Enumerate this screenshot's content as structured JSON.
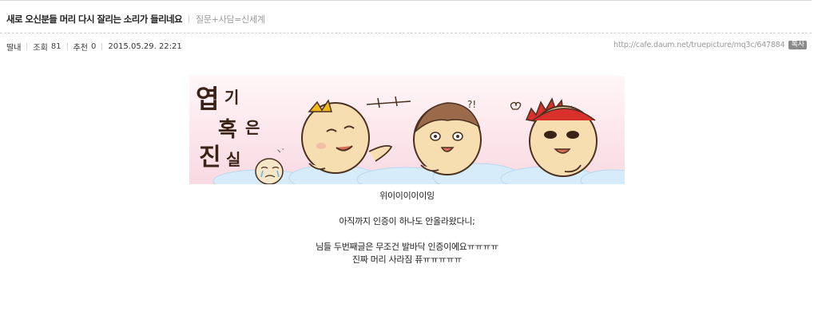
{
  "post": {
    "title": "새로 오신분들 머리 다시 잘리는 소리가 들리네요",
    "category": "질문+사담=신세계"
  },
  "meta": {
    "author": "딸내",
    "views_label": "조회",
    "views": "81",
    "recommend_label": "추천",
    "recommend": "0",
    "datetime": "2015.05.29. 22:21",
    "url": "http://cafe.daum.net/truepicture/mq3c/647884",
    "copy_label": "복사"
  },
  "banner": {
    "text": "엽기혹은진실",
    "colors": {
      "background": "#fde3ea",
      "clouds": "#d6ecfb",
      "skin": "#f7deb0",
      "text": "#3a2216"
    }
  },
  "body": {
    "lines": [
      "위이이이이이잉",
      "아직까지 인증이 하나도 안올라왔다니;",
      "님들 두번째글은 무조건 발바닥 인증이에요ㅠㅠㅠㅠ",
      "진짜 머리 사라짐 퓨ㅠㅠㅠㅠㅠ"
    ]
  }
}
